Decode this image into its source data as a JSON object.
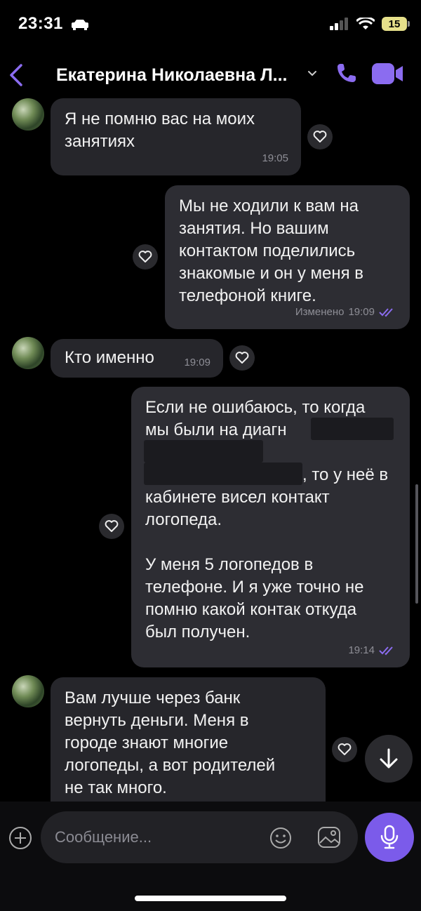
{
  "status_bar": {
    "time": "23:31",
    "battery": "15"
  },
  "header": {
    "title": "Екатерина Николаевна Л..."
  },
  "messages": [
    {
      "text": "Я не помню вас на моих\nзанятиях",
      "time": "19:05"
    },
    {
      "text": "Мы не ходили к вам на\nзанятия. Но вашим\nконтактом поделились\nзнакомые и он у меня в\nтелефоной книге.",
      "edited": "Изменено",
      "time": "19:09"
    },
    {
      "text": "Кто именно",
      "time": "19:09"
    },
    {
      "line1": "Если не ошибаюсь, то когда",
      "line2": "мы были на диагн",
      "line3": "",
      "line4": ", то у неё в",
      "rest": "кабинете висел контакт\nлогопеда.\n\nУ меня 5 логопедов в\nтелефоне. И я уже точно не\nпомню какой контак откуда\nбыл получен.",
      "time": "19:14"
    },
    {
      "text": "Вам лучше через банк\nвернуть деньги. Меня в\nгороде знают многие\nлогопеды, а вот родителей\nне так много."
    }
  ],
  "composer": {
    "placeholder": "Сообщение..."
  },
  "colors": {
    "accent": "#7b5bea",
    "bubble": "#26262b",
    "background": "#000000"
  },
  "icons": [
    "back-chevron-icon",
    "chevron-down-icon",
    "phone-icon",
    "video-icon",
    "heart-icon",
    "arrow-down-icon",
    "plus-icon",
    "emoji-icon",
    "gallery-icon",
    "mic-icon",
    "double-check-icon"
  ]
}
